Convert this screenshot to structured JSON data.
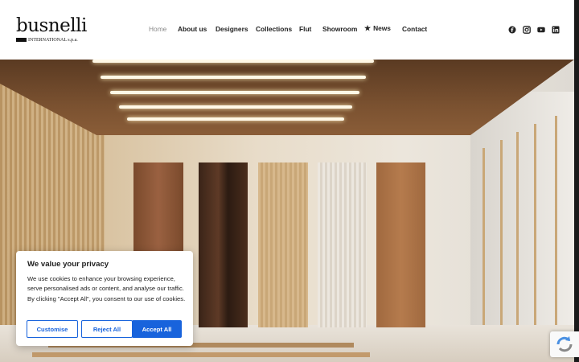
{
  "brand": {
    "name": "busnelli",
    "subline": "INTERNATIONAL s.p.a."
  },
  "nav": {
    "items": [
      {
        "label": "Home",
        "active": true
      },
      {
        "label": "About us"
      },
      {
        "label": "Designers"
      },
      {
        "label": "Collections"
      },
      {
        "label": "Flut"
      },
      {
        "label": "Showroom"
      },
      {
        "label": "News",
        "icon": "star-icon"
      },
      {
        "label": "Contact"
      }
    ]
  },
  "social": [
    "facebook-icon",
    "instagram-icon",
    "youtube-icon",
    "linkedin-icon"
  ],
  "cookie": {
    "title": "We value your privacy",
    "text": "We use cookies to enhance your browsing experience, serve personalised ads or content, and analyse our traffic. By clicking \"Accept All\", you consent to our use of cookies.",
    "customise": "Customise",
    "reject": "Reject All",
    "accept": "Accept All",
    "accent": "#1863dc"
  },
  "hero": {
    "image": "wood panels showroom"
  }
}
